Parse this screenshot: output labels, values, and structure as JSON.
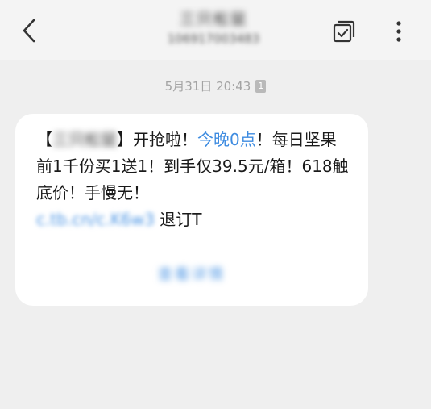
{
  "header": {
    "title": "三只松鼠",
    "subtitle": "106917003483"
  },
  "message": {
    "timestamp": "5月31日 20:43",
    "sim_badge": "1",
    "text_open_bracket": "【",
    "sender": "三只松鼠",
    "text_close_bracket_body": "】开抢啦！",
    "highlight": "今晚0点",
    "body": "！每日坚果前1千份买1送1！到手仅39.5元/箱！618触底价！手慢无！",
    "link": "c.tb.cn/c.K6w3",
    "unsubscribe": " 退订T",
    "action": "查看详情"
  },
  "icons": {
    "back": "chevron-left-icon",
    "copy": "copy-check-icon",
    "more": "more-vertical-icon"
  },
  "colors": {
    "link": "#4a94e4",
    "highlight": "#3d8be0",
    "background": "#efefef",
    "bubble": "#ffffff"
  }
}
